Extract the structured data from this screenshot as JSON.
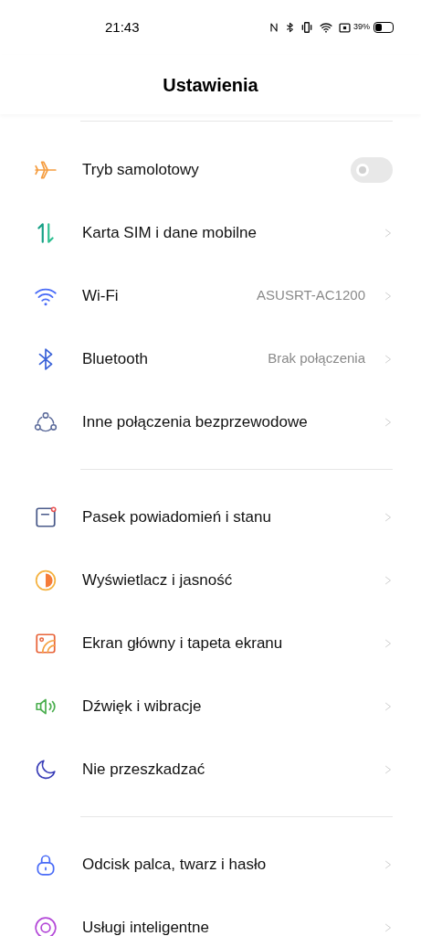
{
  "status_bar": {
    "time": "21:43",
    "battery_percent": "39%"
  },
  "header": {
    "title": "Ustawienia"
  },
  "groups": [
    {
      "items": [
        {
          "kind": "toggle",
          "label": "Tryb samolotowy",
          "on": false
        },
        {
          "kind": "link",
          "label": "Karta SIM i dane mobilne"
        },
        {
          "kind": "link",
          "label": "Wi-Fi",
          "value": "ASUSRT-AC1200"
        },
        {
          "kind": "link",
          "label": "Bluetooth",
          "value": "Brak połączenia"
        },
        {
          "kind": "link",
          "label": "Inne połączenia bezprzewodowe"
        }
      ]
    },
    {
      "items": [
        {
          "kind": "link",
          "label": "Pasek powiadomień i stanu"
        },
        {
          "kind": "link",
          "label": "Wyświetlacz i jasność"
        },
        {
          "kind": "link",
          "label": "Ekran główny i tapeta ekranu"
        },
        {
          "kind": "link",
          "label": "Dźwięk i wibracje"
        },
        {
          "kind": "link",
          "label": "Nie przeszkadzać"
        }
      ]
    },
    {
      "items": [
        {
          "kind": "link",
          "label": "Odcisk palca, twarz i hasło"
        },
        {
          "kind": "link",
          "label": "Usługi inteligentne"
        }
      ]
    }
  ]
}
